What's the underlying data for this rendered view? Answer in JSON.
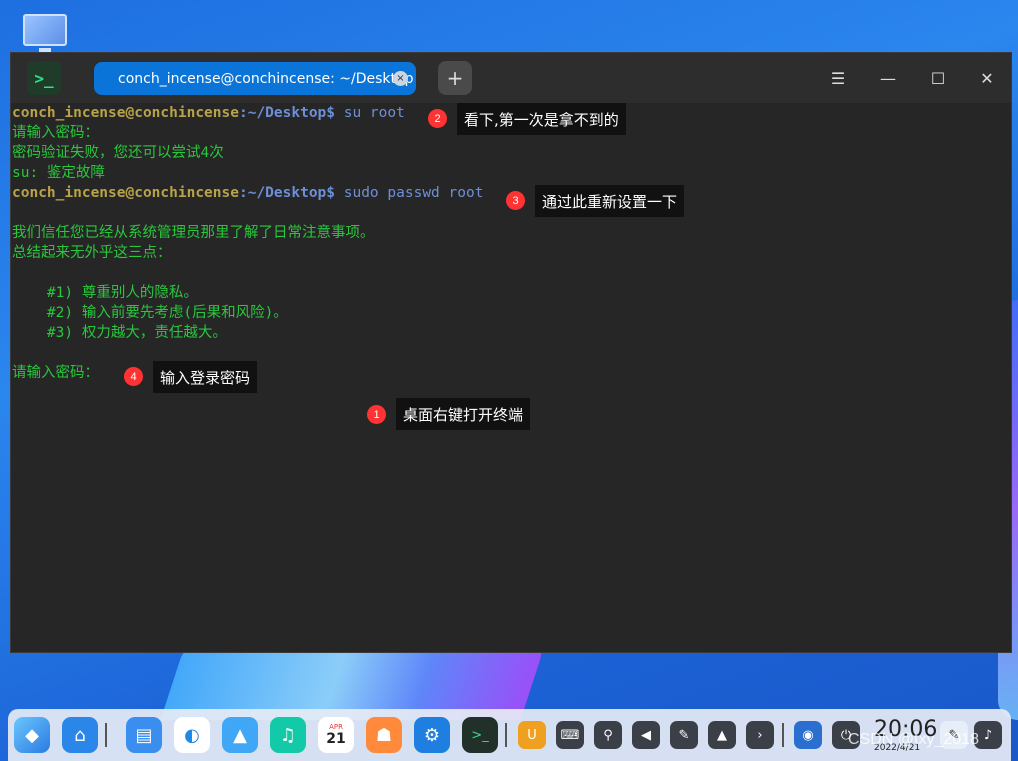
{
  "window": {
    "tab_title": "conch_incense@conchincense: ~/Desktop",
    "tab_close": "×",
    "new_tab": "+",
    "menu": "☰",
    "minimize": "—",
    "maximize": "☐",
    "close": "✕",
    "logo": ">_"
  },
  "terminal": {
    "lines": [
      {
        "user": "conch_incense@conchincense",
        "path": ":~/Desktop$",
        "cmd": " su root"
      },
      {
        "text": "请输入密码："
      },
      {
        "text": "密码验证失败，您还可以尝试4次"
      },
      {
        "text": "su: 鉴定故障"
      },
      {
        "user": "conch_incense@conchincense",
        "path": ":~/Desktop$",
        "cmd": " sudo passwd root"
      },
      {
        "text": ""
      },
      {
        "text": "我们信任您已经从系统管理员那里了解了日常注意事项。"
      },
      {
        "text": "总结起来无外乎这三点："
      },
      {
        "text": ""
      },
      {
        "text": "    #1) 尊重别人的隐私。"
      },
      {
        "text": "    #2) 输入前要先考虑(后果和风险)。"
      },
      {
        "text": "    #3) 权力越大，责任越大。"
      },
      {
        "text": ""
      },
      {
        "text": "请输入密码："
      }
    ]
  },
  "annotations": [
    {
      "num": "1",
      "text": "桌面右键打开终端"
    },
    {
      "num": "2",
      "text": "看下,第一次是拿不到的"
    },
    {
      "num": "3",
      "text": "通过此重新设置一下"
    },
    {
      "num": "4",
      "text": "输入登录密码"
    }
  ],
  "dock": {
    "calendar_month": "APR",
    "calendar_day": "21",
    "time": "20:06",
    "date": "2022/4/21",
    "watermark": "CSDN @txy_2018"
  }
}
